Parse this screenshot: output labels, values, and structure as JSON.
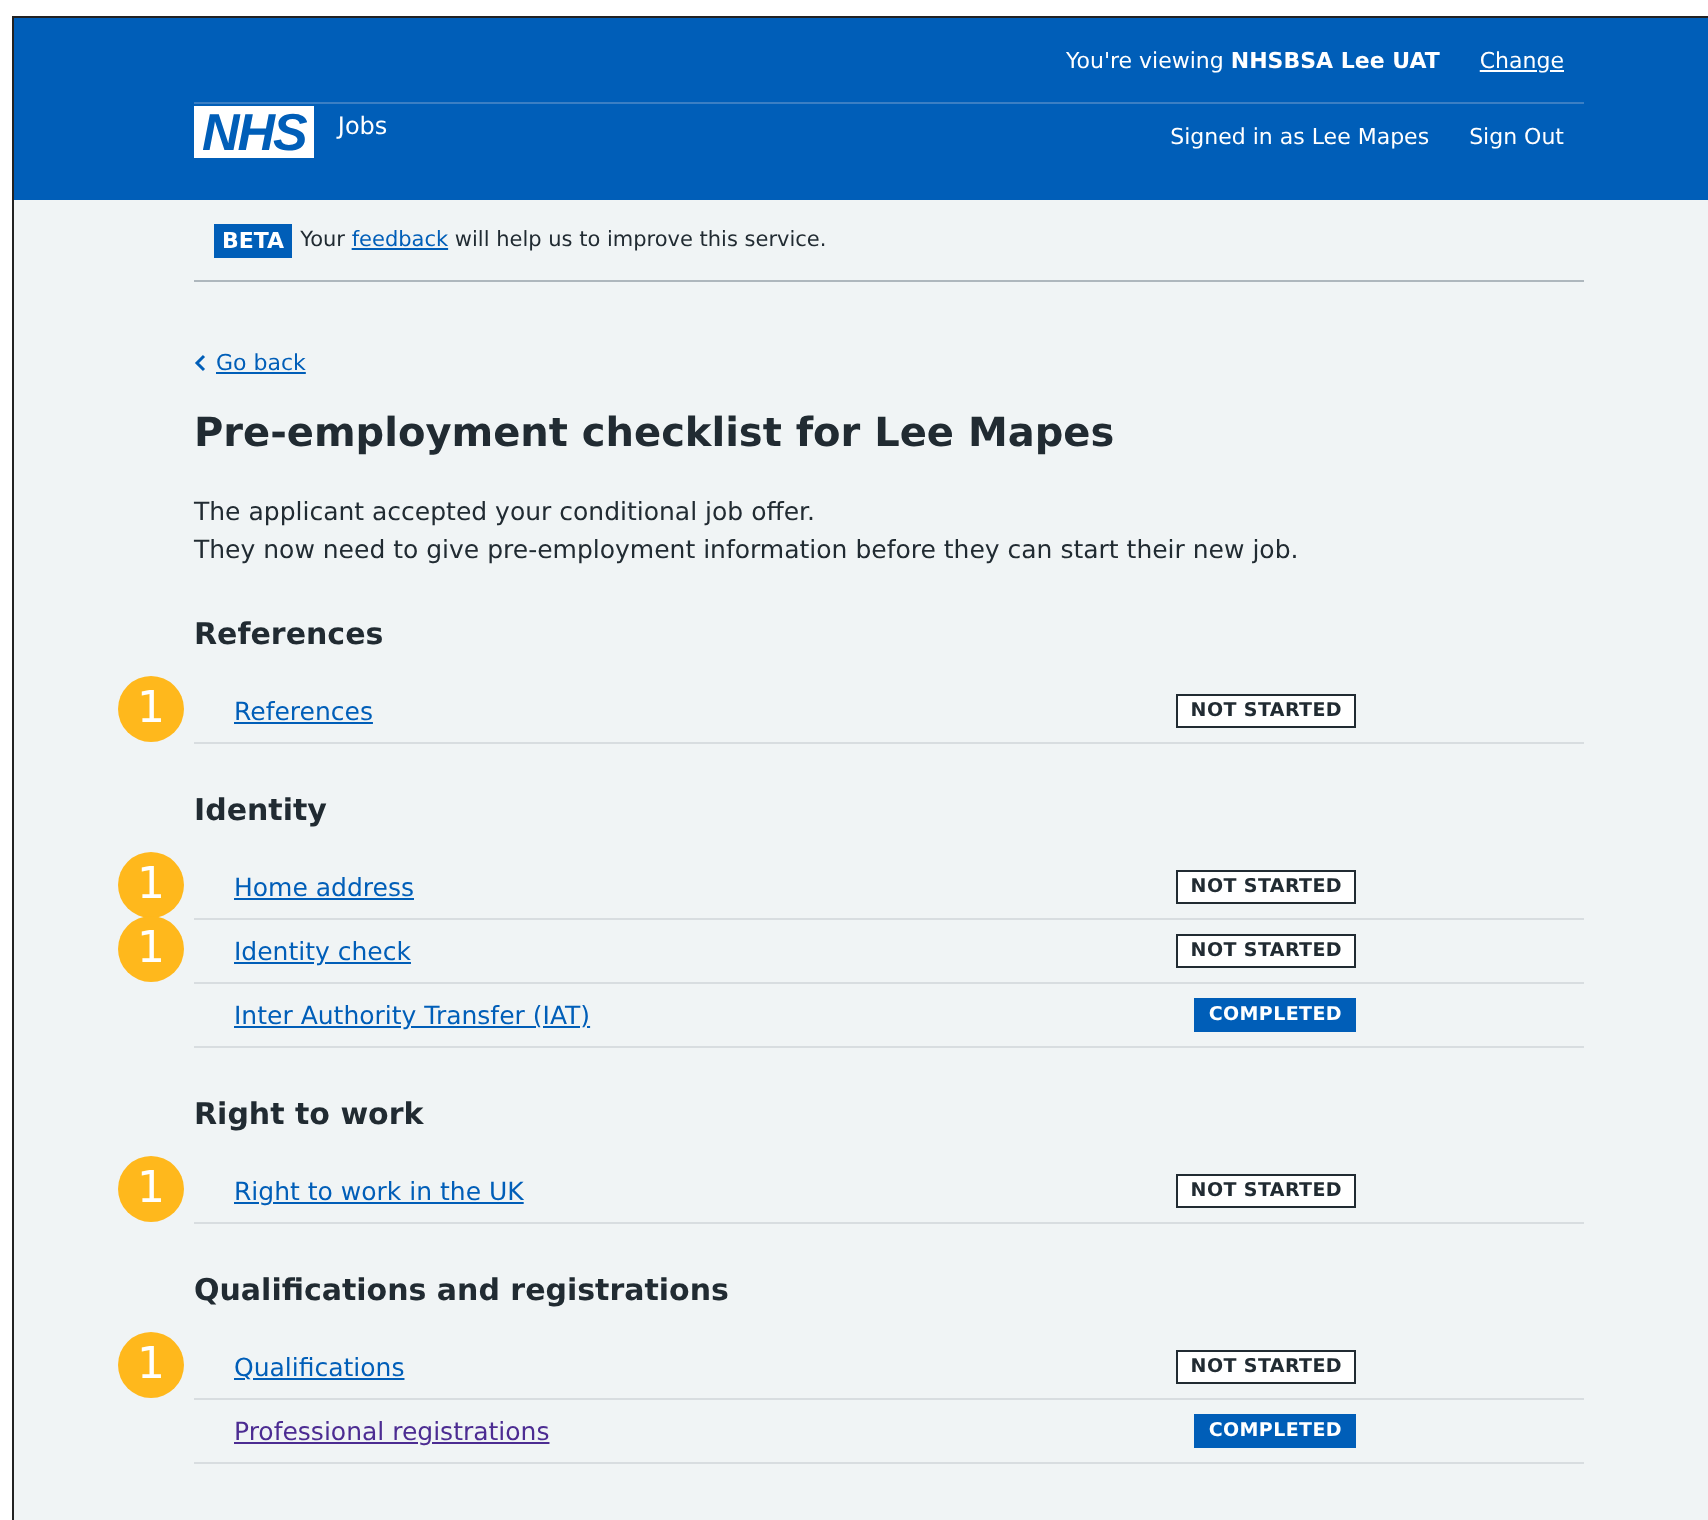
{
  "header": {
    "logo": "NHS",
    "service": "Jobs",
    "viewing_prefix": "You're viewing ",
    "viewing_org": "NHSBSA Lee UAT",
    "change_link": "Change",
    "signed_in": "Signed in as Lee Mapes",
    "sign_out": "Sign Out"
  },
  "beta_banner": {
    "tag": "BETA",
    "text_before": "Your ",
    "link": "feedback",
    "text_after": " will help us to improve this service."
  },
  "back_link": "Go back",
  "title": "Pre-employment checklist for Lee Mapes",
  "intro": [
    "The applicant accepted your conditional job offer.",
    "They now need to give pre-employment information before they can start their new job."
  ],
  "sections": [
    {
      "heading": "References",
      "tasks": [
        {
          "label": "References",
          "status": "NOT STARTED",
          "kind": "not_started",
          "callout": "1",
          "visited": false
        }
      ]
    },
    {
      "heading": "Identity",
      "tasks": [
        {
          "label": "Home address",
          "status": "NOT STARTED",
          "kind": "not_started",
          "callout": "1",
          "visited": false
        },
        {
          "label": "Identity check",
          "status": "NOT STARTED",
          "kind": "not_started",
          "callout": "1",
          "visited": false
        },
        {
          "label": "Inter Authority Transfer (IAT)",
          "status": "COMPLETED",
          "kind": "completed",
          "visited": false
        }
      ]
    },
    {
      "heading": "Right to work",
      "tasks": [
        {
          "label": "Right to work in the UK",
          "status": "NOT STARTED",
          "kind": "not_started",
          "callout": "1",
          "visited": false
        }
      ]
    },
    {
      "heading": "Qualifications and registrations",
      "tasks": [
        {
          "label": "Qualifications",
          "status": "NOT STARTED",
          "kind": "not_started",
          "callout": "1",
          "visited": false
        },
        {
          "label": "Professional registrations",
          "status": "COMPLETED",
          "kind": "completed",
          "visited": true
        }
      ]
    }
  ]
}
